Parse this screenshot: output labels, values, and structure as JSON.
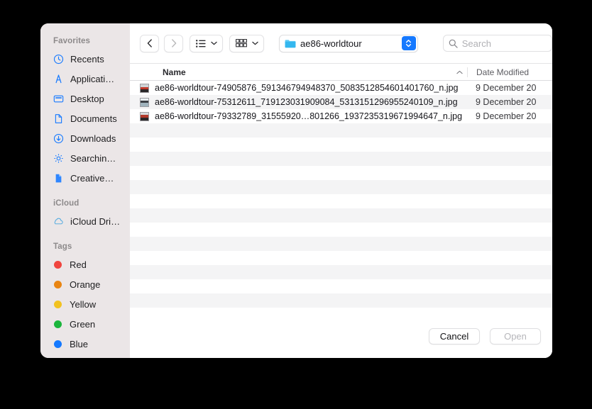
{
  "window": {
    "type": "macos-open-file-dialog"
  },
  "toolbar": {
    "back_icon": "chevron-left-icon",
    "forward_icon": "chevron-right-icon",
    "list_view_icon": "list-view-icon",
    "gallery_view_icon": "gallery-view-icon",
    "dropdown_icon": "chevron-down-icon",
    "path": {
      "folder_icon": "folder-icon",
      "label": "ae86-worldtour",
      "stepper_icon": "up-down-chevron-icon"
    },
    "search": {
      "icon": "search-icon",
      "placeholder": "Search",
      "value": ""
    }
  },
  "sidebar": {
    "sections": [
      {
        "title": "Favorites",
        "items": [
          {
            "label": "Recents",
            "icon": "clock-icon"
          },
          {
            "label": "Applicati…",
            "icon": "applications-icon"
          },
          {
            "label": "Desktop",
            "icon": "desktop-icon"
          },
          {
            "label": "Documents",
            "icon": "document-icon"
          },
          {
            "label": "Downloads",
            "icon": "download-icon"
          },
          {
            "label": "Searchin…",
            "icon": "gear-icon"
          },
          {
            "label": "Creative…",
            "icon": "file-filled-icon"
          }
        ]
      },
      {
        "title": "iCloud",
        "items": [
          {
            "label": "iCloud Dri…",
            "icon": "cloud-icon"
          }
        ]
      },
      {
        "title": "Tags",
        "items": [
          {
            "label": "Red",
            "icon": "tag-dot-icon",
            "color": "#f0453f"
          },
          {
            "label": "Orange",
            "icon": "tag-dot-icon",
            "color": "#e98512"
          },
          {
            "label": "Yellow",
            "icon": "tag-dot-icon",
            "color": "#f2c220"
          },
          {
            "label": "Green",
            "icon": "tag-dot-icon",
            "color": "#1bb53c"
          },
          {
            "label": "Blue",
            "icon": "tag-dot-icon",
            "color": "#1579ff"
          }
        ]
      }
    ]
  },
  "file_list": {
    "columns": {
      "name": "Name",
      "date_modified": "Date Modified",
      "sort_indicator_icon": "chevron-up-icon"
    },
    "rows": [
      {
        "name": "ae86-worldtour-74905876_591346794948370_5083512854601401760_n.jpg",
        "date": "9 December 20",
        "icon": "image-thumbnail-icon"
      },
      {
        "name": "ae86-worldtour-75312611_719123031909084_5313151296955240109_n.jpg",
        "date": "9 December 20",
        "icon": "image-thumbnail-icon"
      },
      {
        "name": "ae86-worldtour-79332789_31555920…801266_1937235319671994647_n.jpg",
        "date": "9 December 20",
        "icon": "image-thumbnail-icon"
      }
    ],
    "empty_row_count": 14
  },
  "footer": {
    "cancel_label": "Cancel",
    "open_label": "Open",
    "open_disabled": true
  },
  "colors": {
    "accent": "#1579ff",
    "sidebar_bg": "#ebe6e7",
    "stripe": "#f4f4f5"
  }
}
